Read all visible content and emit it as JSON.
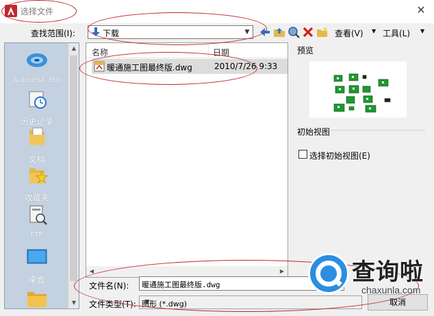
{
  "window": {
    "title": "选择文件",
    "close_glyph": "✕"
  },
  "toolbar": {
    "look_in_label": "查找范围(I):",
    "look_in_value": "下载",
    "views_label": "查看(V)",
    "tools_label": "工具(L)",
    "icons": [
      "back-arrow-icon",
      "up-folder-icon",
      "search-web-icon",
      "delete-icon",
      "new-folder-icon"
    ]
  },
  "places": [
    {
      "label": "Autodesk 360",
      "icon": "autodesk-360-icon"
    },
    {
      "label": "历史记录",
      "icon": "history-icon"
    },
    {
      "label": "文档",
      "icon": "documents-icon"
    },
    {
      "label": "收藏夹",
      "icon": "favorites-icon"
    },
    {
      "label": "FTP",
      "icon": "ftp-icon"
    },
    {
      "label": "桌面",
      "icon": "desktop-icon"
    }
  ],
  "file_list": {
    "columns": [
      "名称",
      "日期"
    ],
    "rows": [
      {
        "name": "暖通施工图最终版.dwg",
        "date": "2010/7/26 9:33"
      }
    ]
  },
  "preview": {
    "label": "预览"
  },
  "initial_view": {
    "group_label": "初始视图",
    "checkbox_label": "选择初始视图(E)",
    "checked": false
  },
  "file_name": {
    "label": "文件名(N):",
    "value": "暖通施工图最终版.dwg"
  },
  "file_type": {
    "label": "文件类型(T):",
    "value": "图形 (*.dwg)"
  },
  "buttons": {
    "cancel": "取消"
  },
  "watermark": {
    "brand": "查询啦",
    "url": "chaxunla.com"
  },
  "colors": {
    "annotation": "#c0282c",
    "watermark_blue": "#2b8ee0",
    "places_bg": "#c3d1e0"
  }
}
